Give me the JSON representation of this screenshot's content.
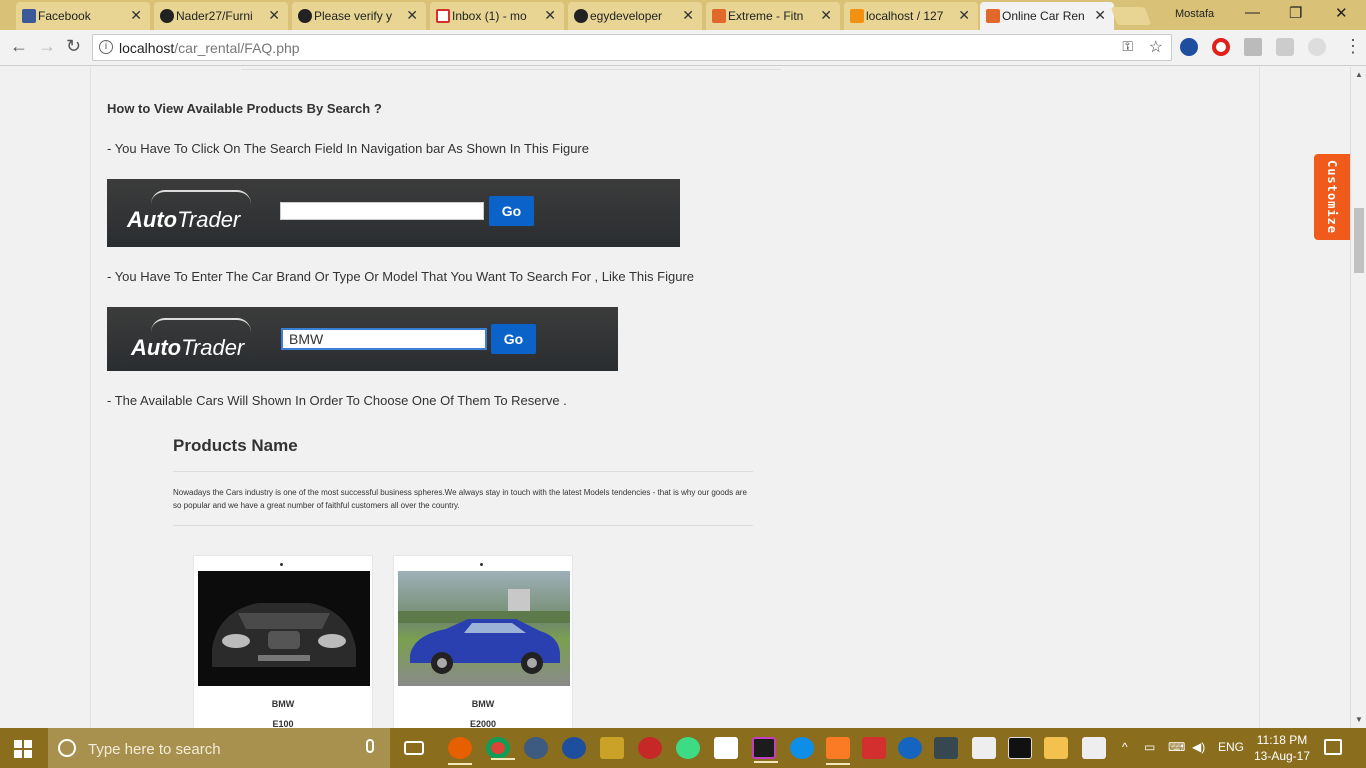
{
  "browser": {
    "tabs": [
      {
        "label": "Facebook",
        "color": "#3b5998"
      },
      {
        "label": "Nader27/Furni",
        "color": "#222222"
      },
      {
        "label": "Please verify y",
        "color": "#222222"
      },
      {
        "label": "Inbox (1) - mo",
        "color": "#d93025"
      },
      {
        "label": "egydeveloper",
        "color": "#222222"
      },
      {
        "label": "Extreme - Fitn",
        "color": "#e2672b"
      },
      {
        "label": "localhost / 127",
        "color": "#f29111"
      },
      {
        "label": "Online Car Ren",
        "color": "#e2672b"
      }
    ],
    "user": "Mostafa",
    "url_host": "localhost",
    "url_path": "/car_rental/FAQ.php"
  },
  "faq": {
    "question": "How to View Available Products By Search ?",
    "step1": "- You Have To Click On The Search Field In Navigation bar As Shown In This Figure",
    "step2": "- You Have To Enter The Car Brand Or Type Or Model That You Want To Search For , Like This Figure",
    "step3": "- The Available Cars Will Shown In Order To Choose One Of Them To Reserve ."
  },
  "figure1": {
    "logo_auto": "Auto",
    "logo_trader": "Trader",
    "input_value": "",
    "go_label": "Go"
  },
  "figure2": {
    "logo_auto": "Auto",
    "logo_trader": "Trader",
    "input_value": "BMW",
    "go_label": "Go"
  },
  "products": {
    "title": "Products Name",
    "description": "Nowadays the Cars industry is one of the most successful business spheres.We always stay in touch with the latest Models tendencies - that is why our goods are so popular and we have a great number of faithful customers all over the country.",
    "items": [
      {
        "brand": "BMW",
        "model": "E100",
        "car_color": "#111111"
      },
      {
        "brand": "BMW",
        "model": "E2000",
        "car_color": "#2a3fb0"
      }
    ]
  },
  "customize_label": "Customize",
  "taskbar": {
    "search_placeholder": "Type here to search",
    "language": "ENG",
    "time": "11:18 PM",
    "date": "13-Aug-17"
  }
}
